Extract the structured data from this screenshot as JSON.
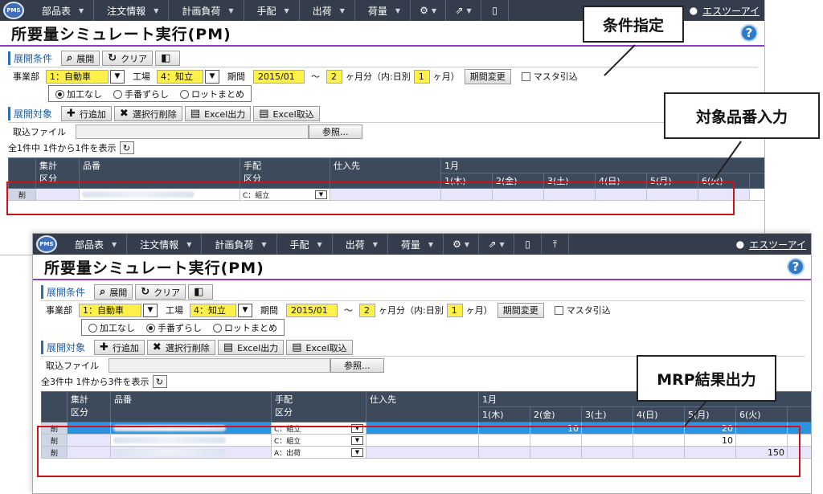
{
  "nav": {
    "logo": "PMS",
    "items": [
      "部品表",
      "注文情報",
      "計画負荷",
      "手配",
      "出荷",
      "荷量"
    ],
    "icons": [
      "gear-icon",
      "share-icon",
      "door-icon",
      "upload-icon"
    ],
    "user": "エスツーアイ",
    "caret": "▼"
  },
  "page": {
    "title": "所要量シミュレート実行(PM)",
    "help": "?"
  },
  "cond": {
    "label": "展開条件",
    "btn_expand": "展開",
    "btn_clear": "クリア",
    "dept_label": "事業部",
    "dept_value": "1：自動車",
    "plant_label": "工場",
    "plant_value": "4：知立",
    "period_label": "期間",
    "period_start": "2015/01",
    "tilde": "～",
    "months": "2",
    "months_text": "ヶ月分（内:日別",
    "days": "1",
    "days_close": "ヶ月）",
    "period_btn": "期間変更",
    "master_label": "マスタ引込",
    "radio": [
      "加工なし",
      "手番ずらし",
      "ロットまとめ"
    ]
  },
  "target": {
    "label": "展開対象",
    "add_row": "行追加",
    "del_rows": "選択行削除",
    "excel_out": "Excel出力",
    "excel_in": "Excel取込",
    "file_label": "取込ファイル",
    "browse": "参照...",
    "refresh_icon": "↻"
  },
  "table": {
    "h_total": "集計\n区分",
    "h_part": "品番",
    "h_arr": "手配\n区分",
    "h_supplier": "仕入先",
    "h_month": "1月",
    "h_days": [
      "1(木)",
      "2(金)",
      "3(土)",
      "4(日)",
      "5(月)",
      "6(火)"
    ],
    "del_label": "削"
  },
  "screen1": {
    "count": "全1件中 1件から1件を表示",
    "radio_selected": 0,
    "rows": [
      {
        "arr": "C：組立",
        "vals": [
          "",
          "",
          "",
          "",
          "",
          ""
        ]
      }
    ]
  },
  "screen2": {
    "count": "全3件中 1件から3件を表示",
    "radio_selected": 1,
    "rows": [
      {
        "arr": "C：組立",
        "vals": [
          "",
          "10",
          "",
          "",
          "20",
          ""
        ]
      },
      {
        "arr": "C：組立",
        "vals": [
          "",
          "",
          "",
          "",
          "10",
          ""
        ]
      },
      {
        "arr": "A：出荷",
        "vals": [
          "",
          "",
          "",
          "",
          "",
          "150"
        ]
      }
    ]
  },
  "callouts": {
    "c1": "条件指定",
    "c2": "対象品番入力",
    "c3": "MRP結果出力"
  },
  "colors": {
    "nav": "#353d4c",
    "accent": "#8a3cc6",
    "highlight": "#2e93de",
    "input": "#fff04a",
    "callout_border": "#d0121b"
  }
}
